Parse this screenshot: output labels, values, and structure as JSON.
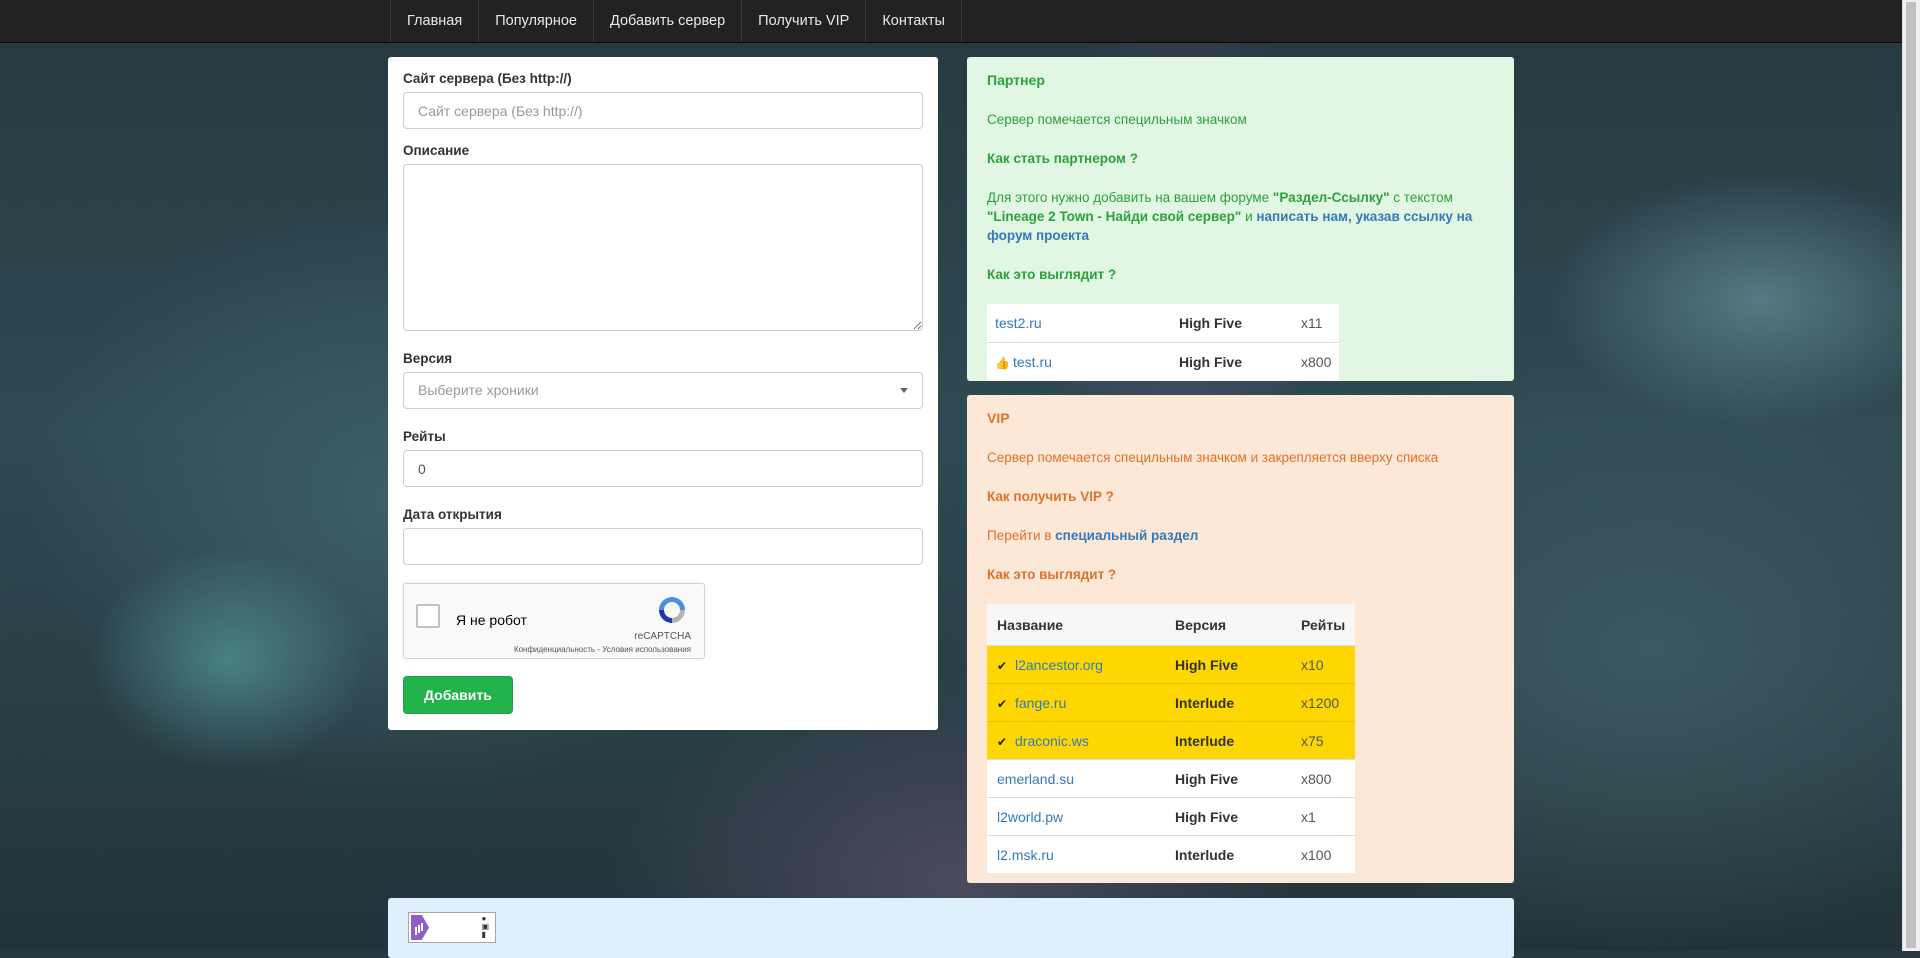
{
  "nav": {
    "items": [
      {
        "label": "Главная"
      },
      {
        "label": "Популярное"
      },
      {
        "label": "Добавить сервер"
      },
      {
        "label": "Получить VIP"
      },
      {
        "label": "Контакты"
      }
    ]
  },
  "form": {
    "site_label": "Сайт сервера (Без http://)",
    "site_placeholder": "Сайт сервера (Без http://)",
    "description_label": "Описание",
    "version_label": "Версия",
    "version_placeholder": "Выберите хроники",
    "rates_label": "Рейты",
    "rates_value": "0",
    "open_date_label": "Дата открытия",
    "captcha_label": "Я не робот",
    "captcha_brand": "reCAPTCHA",
    "captcha_terms": "Конфиденциальность - Условия использования",
    "submit_label": "Добавить"
  },
  "partner": {
    "title": "Партнер",
    "desc": "Сервер помечается специльным значком",
    "how_title": "Как стать партнером ?",
    "how_text_1": "Для этого нужно добавить на вашем форуме ",
    "how_highlight_1": "\"Раздел-Ссылку\"",
    "how_text_2": " с текстом ",
    "how_highlight_2": "\"Lineage 2 Town - Найди свой сервер\"",
    "how_text_3": " и ",
    "how_link": "написать нам, указав ссылку на форум проекта",
    "look_title": "Как это выглядит ?",
    "table": [
      {
        "name": "test2.ru",
        "version": "High Five",
        "rate": "x11",
        "icon": "none"
      },
      {
        "name": "test.ru",
        "version": "High Five",
        "rate": "x800",
        "icon": "thumbs-up-icon"
      }
    ]
  },
  "vip": {
    "title": "VIP",
    "desc": "Сервер помечается специльным значком и закрепляется вверху списка",
    "how_title": "Как получить VIP ?",
    "how_text": "Перейти в ",
    "how_link": "специальный раздел",
    "look_title": "Как это выглядит ?",
    "headers": {
      "name": "Название",
      "version": "Версия",
      "rate": "Рейты"
    },
    "rows": [
      {
        "name": "l2ancestor.org",
        "version": "High Five",
        "rate": "x10",
        "vip": true
      },
      {
        "name": "fange.ru",
        "version": "Interlude",
        "rate": "x1200",
        "vip": true
      },
      {
        "name": "draconic.ws",
        "version": "Interlude",
        "rate": "x75",
        "vip": true
      },
      {
        "name": "emerland.su",
        "version": "High Five",
        "rate": "x800",
        "vip": false
      },
      {
        "name": "l2world.pw",
        "version": "High Five",
        "rate": "x1",
        "vip": false
      },
      {
        "name": "l2.msk.ru",
        "version": "Interlude",
        "rate": "x100",
        "vip": false
      }
    ]
  },
  "colors": {
    "partner_bg": "#e1f7e3",
    "partner_text": "#2ca33a",
    "vip_bg": "#fde8d8",
    "vip_text": "#e0722a",
    "vip_row": "#ffd700",
    "submit_button": "#22b34a",
    "link": "#337ab7"
  }
}
